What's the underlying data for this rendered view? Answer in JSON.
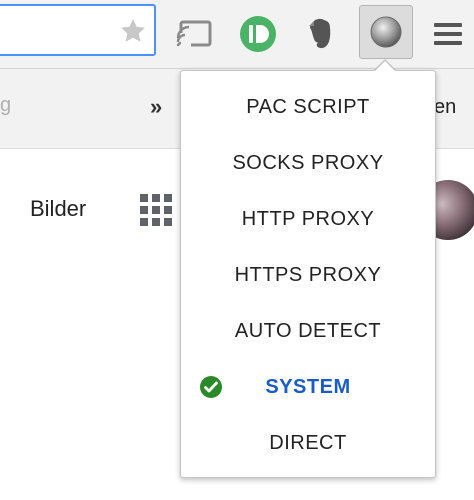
{
  "toolbar": {
    "icons": [
      "star-icon",
      "cast-icon",
      "pushbullet-icon",
      "evernote-icon",
      "proxy-extension-icon",
      "hamburger-menu-icon"
    ]
  },
  "bookmarks": {
    "left_fragment": "g",
    "chevron": "»",
    "right_fragment": "en"
  },
  "page": {
    "bilder": "Bilder"
  },
  "proxy_menu": {
    "items": [
      {
        "label": "PAC SCRIPT",
        "selected": false
      },
      {
        "label": "SOCKS PROXY",
        "selected": false
      },
      {
        "label": "HTTP PROXY",
        "selected": false
      },
      {
        "label": "HTTPS PROXY",
        "selected": false
      },
      {
        "label": "AUTO DETECT",
        "selected": false
      },
      {
        "label": "SYSTEM",
        "selected": true
      },
      {
        "label": "DIRECT",
        "selected": false
      }
    ],
    "selected_color": "#1a5bc4",
    "check_color": "#2a8a2a"
  }
}
